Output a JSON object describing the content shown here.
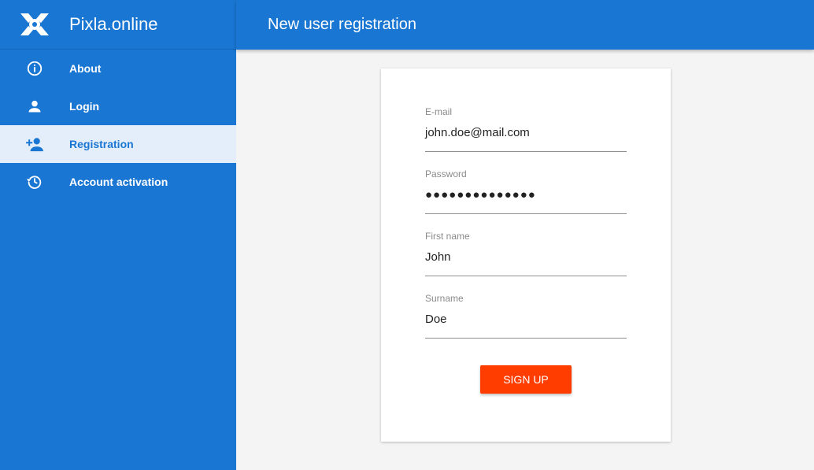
{
  "app": {
    "name": "Pixla.online"
  },
  "colors": {
    "primary": "#1976d2",
    "accent": "#ff3d00",
    "active_bg": "#e3eefa",
    "background": "#f4f4f4"
  },
  "sidebar": {
    "items": [
      {
        "label": "About",
        "icon": "info-icon"
      },
      {
        "label": "Login",
        "icon": "person-icon"
      },
      {
        "label": "Registration",
        "icon": "person-add-icon",
        "active": true
      },
      {
        "label": "Account activation",
        "icon": "history-icon"
      }
    ]
  },
  "header": {
    "title": "New user registration"
  },
  "form": {
    "email": {
      "label": "E-mail",
      "value": "john.doe@mail.com"
    },
    "password": {
      "label": "Password",
      "value": "●●●●●●●●●●●●●●"
    },
    "first_name": {
      "label": "First name",
      "value": "John"
    },
    "surname": {
      "label": "Surname",
      "value": "Doe"
    },
    "submit_label": "SIGN UP"
  }
}
